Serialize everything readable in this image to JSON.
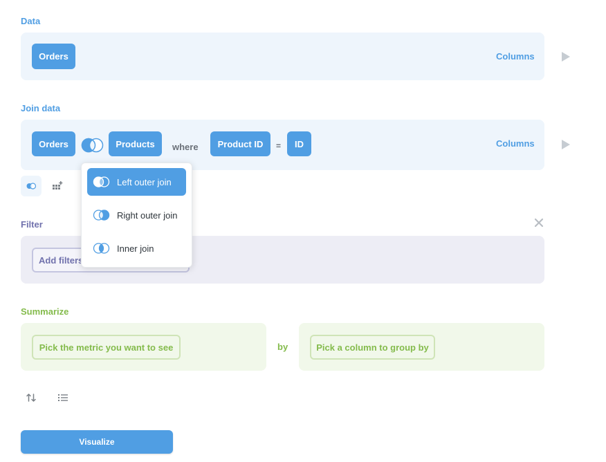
{
  "data_step": {
    "label": "Data",
    "table": "Orders",
    "columns_label": "Columns"
  },
  "join_step": {
    "label": "Join data",
    "left_table": "Orders",
    "right_table": "Products",
    "where_label": "where",
    "left_column": "Product ID",
    "operator": "=",
    "right_column": "ID",
    "columns_label": "Columns"
  },
  "join_popover": {
    "options": [
      {
        "label": "Left outer join",
        "icon": "left-join-icon",
        "selected": true
      },
      {
        "label": "Right outer join",
        "icon": "right-join-icon",
        "selected": false
      },
      {
        "label": "Inner join",
        "icon": "inner-join-icon",
        "selected": false
      }
    ]
  },
  "filter_step": {
    "label": "Filter",
    "add_filters_label": "Add filters"
  },
  "summarize_step": {
    "label": "Summarize",
    "metric_placeholder": "Pick the metric you want to see",
    "by_label": "by",
    "group_placeholder": "Pick a column to group by"
  },
  "visualize_label": "Visualize",
  "colors": {
    "brand": "#509ee3",
    "filter": "#7172ad",
    "summarize": "#84bb4c"
  }
}
